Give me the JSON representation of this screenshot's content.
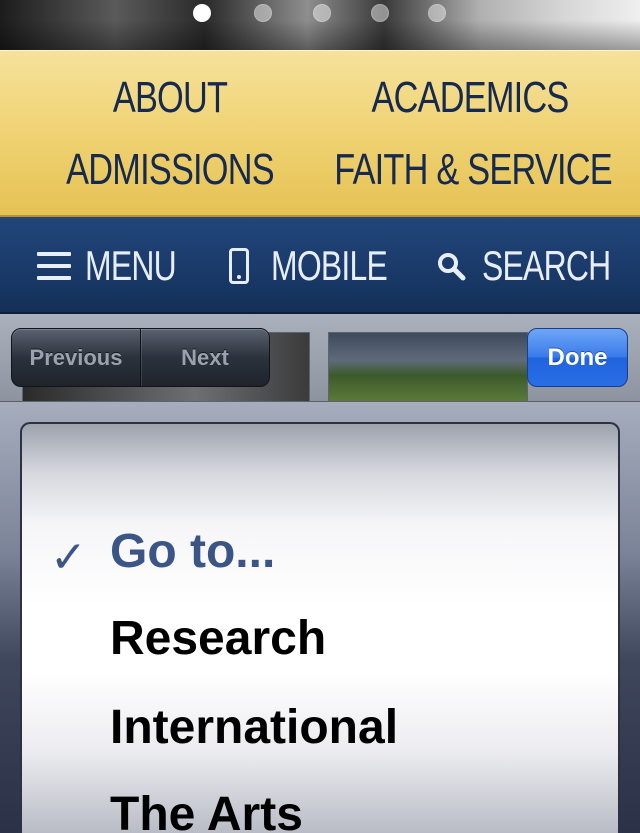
{
  "carousel": {
    "dots": [
      {
        "active": true
      },
      {
        "active": false
      },
      {
        "active": false
      },
      {
        "active": false
      },
      {
        "active": false
      }
    ]
  },
  "primary_nav": {
    "about": "ABOUT",
    "academics": "ACADEMICS",
    "admissions": "ADMISSIONS",
    "faith_service": "FAITH & SERVICE"
  },
  "utility_nav": {
    "menu": "MENU",
    "mobile": "MOBILE",
    "search": "SEARCH"
  },
  "keyboard_toolbar": {
    "previous": "Previous",
    "next": "Next",
    "done": "Done"
  },
  "picker": {
    "check_glyph": "✓",
    "options": [
      {
        "label": "Go to...",
        "selected": true
      },
      {
        "label": "Research",
        "selected": false
      },
      {
        "label": "International",
        "selected": false
      },
      {
        "label": "The Arts",
        "selected": false
      }
    ]
  },
  "colors": {
    "gold": "#f0d477",
    "navy": "#1a3a6a",
    "selected_text": "#3a5586",
    "done_blue": "#2a6ee6"
  }
}
